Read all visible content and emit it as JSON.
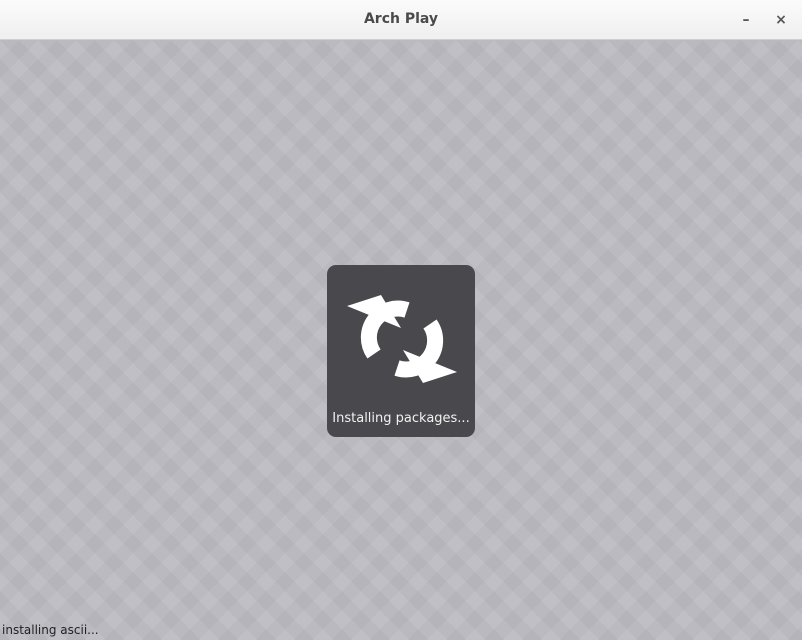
{
  "window": {
    "title": "Arch Play",
    "minimize_symbol": "–",
    "close_symbol": "×"
  },
  "loading": {
    "label": "Installing packages...",
    "icon": "refresh-icon"
  },
  "status": {
    "text": "installing ascii..."
  },
  "colors": {
    "background": "#bbbac1",
    "card": "#49484c",
    "icon": "#ffffff"
  }
}
